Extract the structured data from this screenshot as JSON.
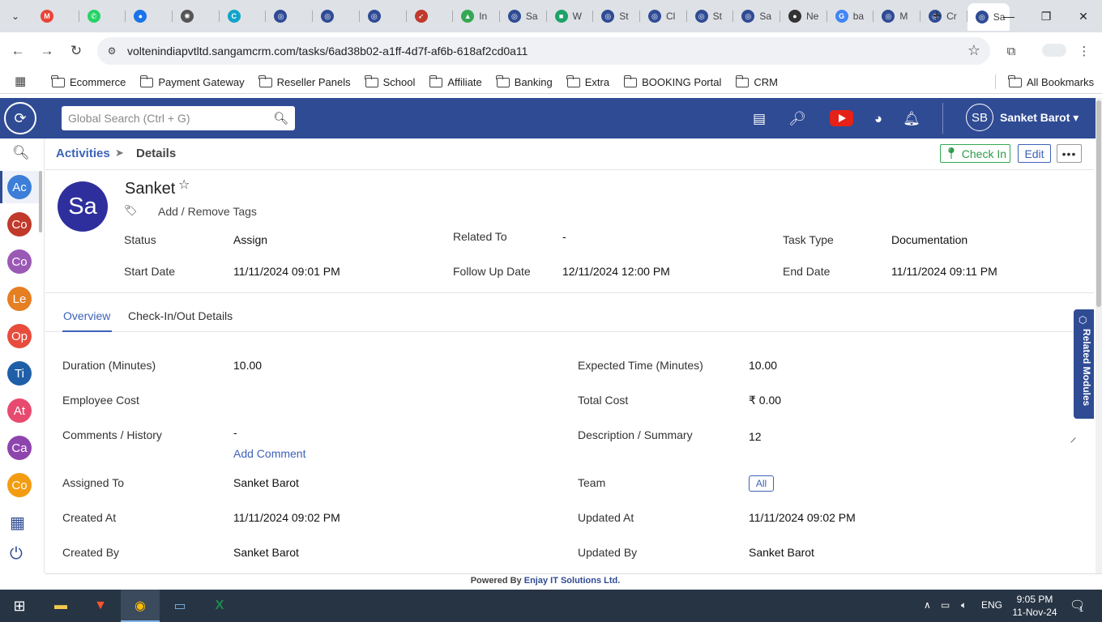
{
  "browser": {
    "tabs": [
      {
        "label": "",
        "icon": "gmail-icon",
        "color": "#ea4335",
        "glyph": "M"
      },
      {
        "label": "",
        "icon": "whatsapp-icon",
        "color": "#25d366",
        "glyph": "✆"
      },
      {
        "label": "",
        "icon": "chat-icon",
        "color": "#1a73e8",
        "glyph": "●"
      },
      {
        "label": "",
        "icon": "openai-icon",
        "color": "#555555",
        "glyph": "✺"
      },
      {
        "label": "",
        "icon": "app-icon",
        "color": "#12a4c9",
        "glyph": "C"
      },
      {
        "label": "",
        "icon": "sangam-icon",
        "color": "#2f4b94",
        "glyph": "◎"
      },
      {
        "label": "",
        "icon": "sangam-icon",
        "color": "#2f4b94",
        "glyph": "◎"
      },
      {
        "label": "",
        "icon": "sangam-icon",
        "color": "#2f4b94",
        "glyph": "◎"
      },
      {
        "label": "",
        "icon": "rocket-icon",
        "color": "#c0392b",
        "glyph": "➶"
      },
      {
        "label": "In",
        "icon": "drive-icon",
        "color": "#34a853",
        "glyph": "▲"
      },
      {
        "label": "Sa",
        "icon": "sangam-icon",
        "color": "#2f4b94",
        "glyph": "◎"
      },
      {
        "label": "W",
        "icon": "bag-icon",
        "color": "#1ca36a",
        "glyph": "■"
      },
      {
        "label": "St",
        "icon": "sangam-icon",
        "color": "#2f4b94",
        "glyph": "◎"
      },
      {
        "label": "Cl",
        "icon": "sangam-icon",
        "color": "#2f4b94",
        "glyph": "◎"
      },
      {
        "label": "St",
        "icon": "sangam-icon",
        "color": "#2f4b94",
        "glyph": "◎"
      },
      {
        "label": "Sa",
        "icon": "sangam-icon",
        "color": "#2f4b94",
        "glyph": "◎"
      },
      {
        "label": "Ne",
        "icon": "github-icon",
        "color": "#333333",
        "glyph": "●"
      },
      {
        "label": "ba",
        "icon": "google-icon",
        "color": "#4285f4",
        "glyph": "G"
      },
      {
        "label": "M",
        "icon": "sangam-icon",
        "color": "#2f4b94",
        "glyph": "◎"
      },
      {
        "label": "Cr",
        "icon": "sangam-icon",
        "color": "#2f4b94",
        "glyph": "◎"
      }
    ],
    "active_tab": {
      "label": "Sa",
      "icon": "sangam-icon"
    },
    "url": "voltenindiapvtltd.sangamcrm.com/tasks/6ad38b02-a1ff-4d7f-af6b-618af2cd0a11",
    "bookmarks": [
      "Ecommerce",
      "Payment Gateway",
      "Reseller Panels",
      "School",
      "Affiliate",
      "Banking",
      "Extra",
      "BOOKING Portal",
      "CRM"
    ],
    "all_bookmarks": "All Bookmarks"
  },
  "header": {
    "search_placeholder": "Global Search (Ctrl + G)",
    "user_initials": "SB",
    "user_name": "Sanket Barot"
  },
  "sidebar": {
    "items": [
      {
        "label": "Ac",
        "color": "#3d7ed8"
      },
      {
        "label": "Co",
        "color": "#c0392b"
      },
      {
        "label": "Co",
        "color": "#9b59b6"
      },
      {
        "label": "Le",
        "color": "#e67e22"
      },
      {
        "label": "Op",
        "color": "#e74c3c"
      },
      {
        "label": "Ti",
        "color": "#1f5fa8"
      },
      {
        "label": "At",
        "color": "#e84a6f"
      },
      {
        "label": "Ca",
        "color": "#8e44ad"
      },
      {
        "label": "Co",
        "color": "#f39c12"
      }
    ]
  },
  "breadcrumb": {
    "parent": "Activities",
    "current": "Details"
  },
  "actions": {
    "checkin": "Check In",
    "edit": "Edit",
    "more": "•••"
  },
  "record": {
    "initials": "Sa",
    "name": "Sanket",
    "tags_link": "Add / Remove Tags",
    "summary": {
      "status_label": "Status",
      "status_value": "Assign",
      "related_label": "Related To",
      "related_value": "-",
      "tasktype_label": "Task Type",
      "tasktype_value": "Documentation",
      "start_label": "Start Date",
      "start_value": "11/11/2024 09:01 PM",
      "followup_label": "Follow Up Date",
      "followup_value": "12/11/2024 12:00 PM",
      "end_label": "End Date",
      "end_value": "11/11/2024 09:11 PM"
    }
  },
  "detail_tabs": [
    "Overview",
    "Check-In/Out Details"
  ],
  "overview": {
    "duration_label": "Duration (Minutes)",
    "duration_value": "10.00",
    "expected_label": "Expected Time (Minutes)",
    "expected_value": "10.00",
    "empcost_label": "Employee Cost",
    "empcost_value": "",
    "totalcost_label": "Total Cost",
    "totalcost_value": "₹ 0.00",
    "comments_label": "Comments / History",
    "comments_value": "-",
    "add_comment": "Add Comment",
    "desc_label": "Description / Summary",
    "desc_value": "12",
    "assigned_label": "Assigned To",
    "assigned_value": "Sanket Barot",
    "team_label": "Team",
    "team_value": "All",
    "created_at_label": "Created At",
    "created_at_value": "11/11/2024 09:02 PM",
    "updated_at_label": "Updated At",
    "updated_at_value": "11/11/2024 09:02 PM",
    "created_by_label": "Created By",
    "created_by_value": "Sanket Barot",
    "updated_by_label": "Updated By",
    "updated_by_value": "Sanket Barot"
  },
  "related_modules": "Related Modules",
  "footer": {
    "prefix": "Powered By",
    "company": "Enjay IT Solutions Ltd."
  },
  "taskbar": {
    "lang": "ENG",
    "time": "9:05 PM",
    "date": "11-Nov-24",
    "notifications": "1"
  }
}
